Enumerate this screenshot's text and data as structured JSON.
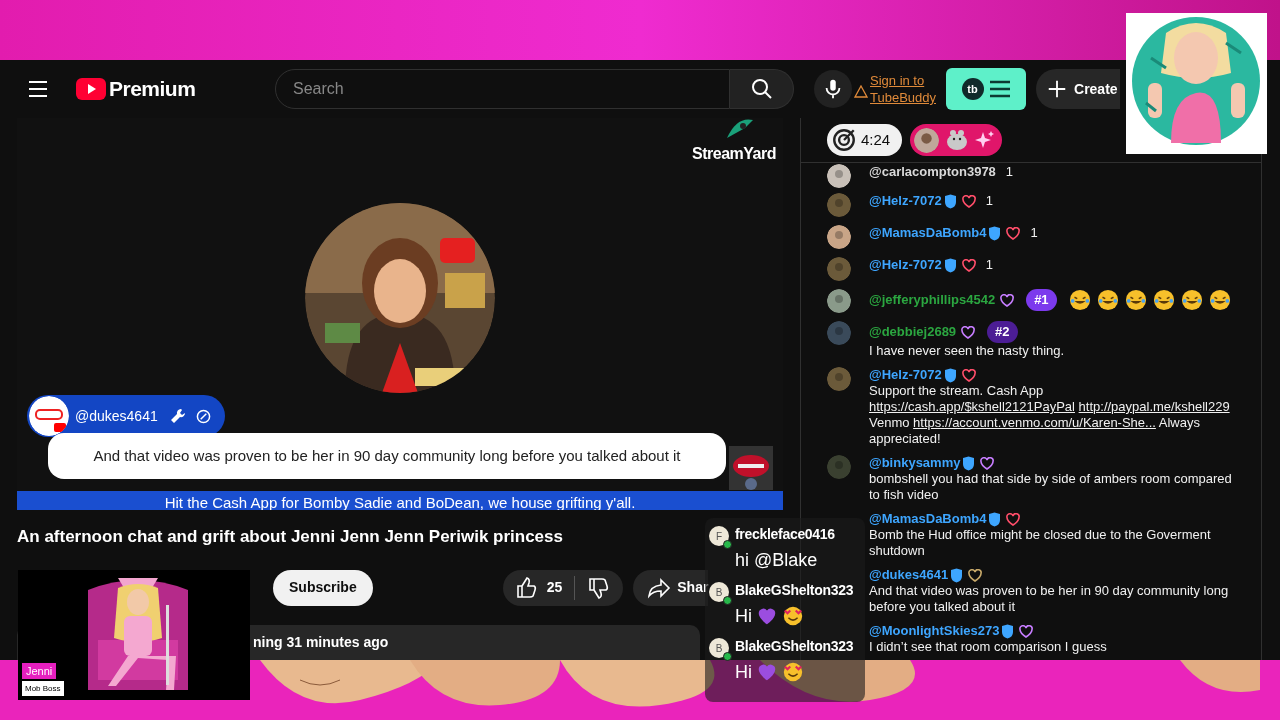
{
  "header": {
    "logo_text": "Premium",
    "search_placeholder": "Search",
    "tubebuddy_link": [
      "Sign in to",
      "TubeBuddy"
    ],
    "tubebuddy_logo": "tb",
    "create_label": "Create"
  },
  "video": {
    "brand": "StreamYard",
    "featured_comment": {
      "author": "@dukes4641",
      "message": "And that video was proven to be her in 90 day community long before you talked about it"
    },
    "ticker": "Hit the Cash App for Bomby Sadie and BoDean, we house grifting y'all."
  },
  "title": "An afternoon chat and grift about Jenni Jenn Jenn Periwik princess",
  "subscribe": "Subscribe",
  "likes": "25",
  "share": "Shar",
  "description": "ning 31 minutes ago",
  "chat": {
    "timer": "4:24",
    "messages": [
      {
        "author": "@carlacompton3978",
        "color": "#d9d9d9",
        "member": false,
        "text": "1"
      },
      {
        "author": "@Helz-7072",
        "color": "#3ea6ff",
        "member": true,
        "heart": {
          "color": "#ff4e6a"
        },
        "text": "1"
      },
      {
        "author": "@MamasDaBomb4",
        "color": "#3ea6ff",
        "member": true,
        "heart": {
          "color": "#ff4e6a"
        },
        "text": "1"
      },
      {
        "author": "@Helz-7072",
        "color": "#3ea6ff",
        "member": true,
        "heart": {
          "color": "#ff4e6a"
        },
        "text": "1"
      },
      {
        "author": "@jefferyphillips4542",
        "color": "#2ba640",
        "member": false,
        "heart": {
          "color": "#c77dff"
        },
        "rank": {
          "label": "#1",
          "color": "#7c3aed"
        },
        "emojis": [
          {
            "kind": "rofl"
          },
          {
            "kind": "rofl"
          },
          {
            "kind": "rofl"
          },
          {
            "kind": "rofl"
          },
          {
            "kind": "rofl"
          },
          {
            "kind": "rofl"
          }
        ]
      },
      {
        "author": "@debbiej2689",
        "color": "#2ba640",
        "member": false,
        "heart": {
          "color": "#c77dff"
        },
        "rank": {
          "label": "#2",
          "color": "#4c1d95"
        },
        "text": "I have never seen the nasty thing."
      },
      {
        "author": "@Helz-7072",
        "color": "#3ea6ff",
        "member": true,
        "heart": {
          "color": "#ff4e6a"
        },
        "segments": [
          {
            "kind": "text",
            "text": "Support the stream. Cash App"
          },
          {
            "kind": "link",
            "text": "https://cash.app/$kshell2121PayPal"
          },
          {
            "kind": "link",
            "text": "http://paypal.me/kshell229"
          },
          {
            "kind": "text",
            "text": "Venmo"
          },
          {
            "kind": "link",
            "text": "https://account.venmo.com/u/Karen-She..."
          },
          {
            "kind": "text",
            "text": "Always appreciated!"
          }
        ]
      },
      {
        "author": "@binkysammy",
        "color": "#3ea6ff",
        "member": true,
        "heart": {
          "color": "#c77dff"
        },
        "text": "bombshell you had that side by side of ambers room compared to fish video"
      },
      {
        "author": "@MamasDaBomb4",
        "color": "#3ea6ff",
        "member": true,
        "heart": {
          "color": "#ff4e6a"
        },
        "text": "Bomb the Hud office might be closed due to the Goverment shutdown"
      },
      {
        "author": "@dukes4641",
        "color": "#3ea6ff",
        "member": true,
        "heart": {
          "color": "#c8a96a"
        },
        "text": "And that video was proven to be her in 90 day community long before you talked about it"
      },
      {
        "author": "@MoonlightSkies273",
        "color": "#3ea6ff",
        "member": true,
        "heart": {
          "color": "#c77dff"
        },
        "text": "I didn’t see that room comparison I guess"
      }
    ]
  },
  "overlay_chat": [
    {
      "initial": "F",
      "name": "freckleface0416",
      "text": "hi @Blake"
    },
    {
      "initial": "B",
      "name": "BlakeGShelton323",
      "text": "Hi",
      "emojis": [
        {
          "kind": "heart"
        },
        {
          "kind": "smile"
        }
      ]
    },
    {
      "initial": "B",
      "name": "BlakeGShelton323",
      "text": "Hi",
      "emojis": [
        {
          "kind": "heart"
        },
        {
          "kind": "smile"
        }
      ]
    }
  ],
  "lower_third": {
    "name": "Jenni",
    "role": "Mob Boss"
  }
}
